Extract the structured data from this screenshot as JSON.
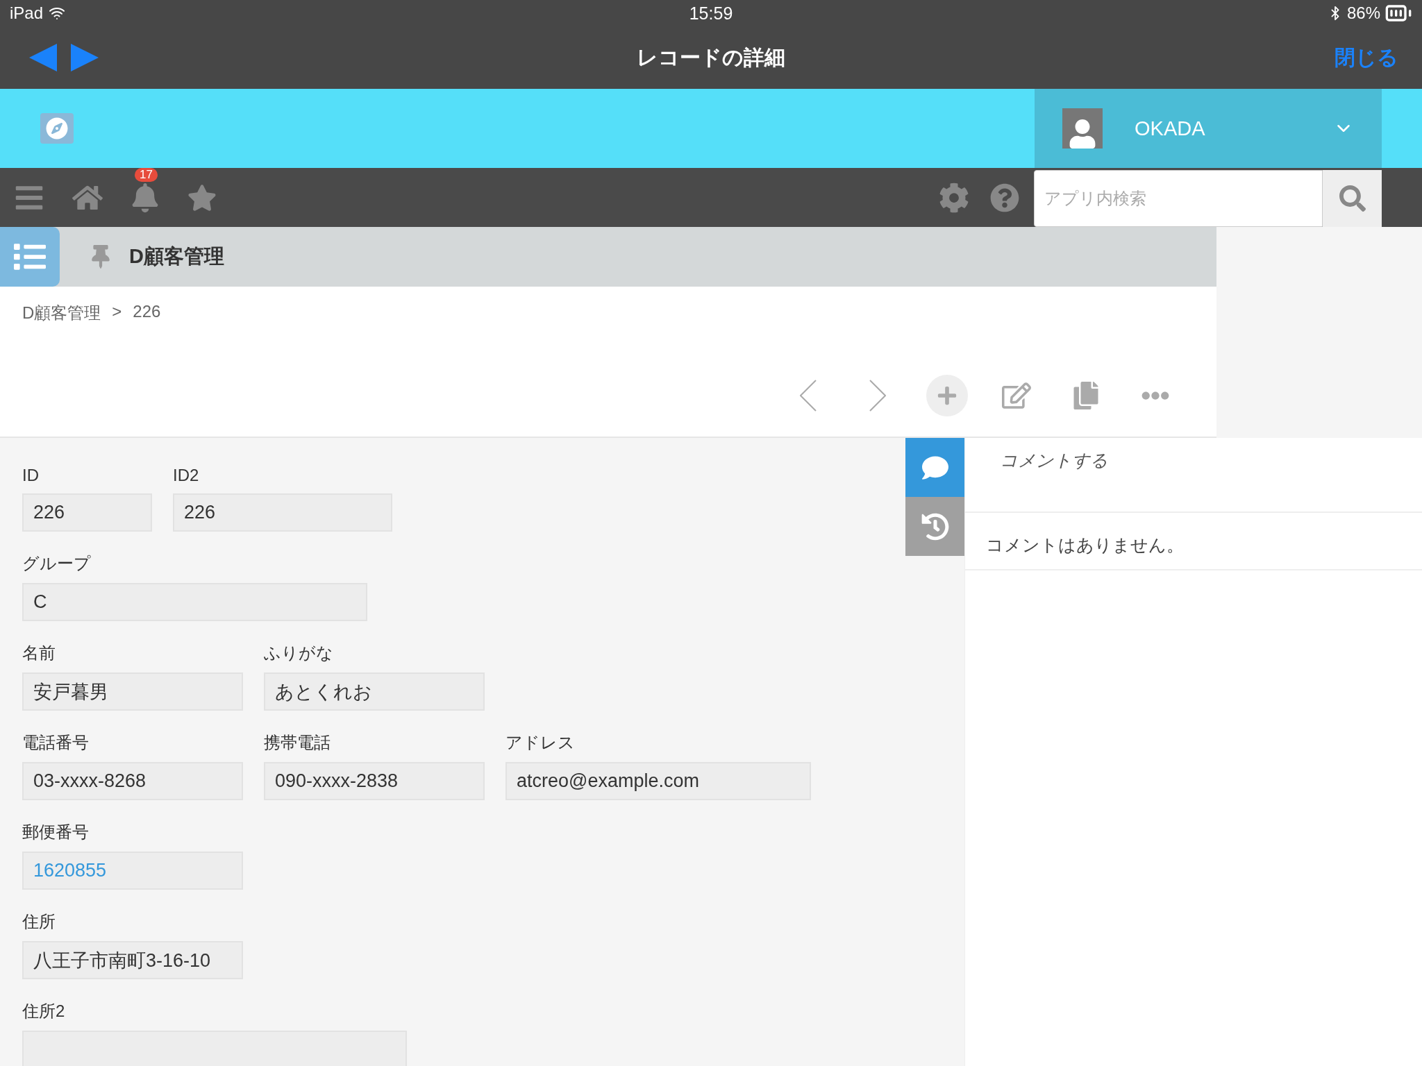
{
  "status_bar": {
    "device": "iPad",
    "time": "15:59",
    "battery": "86%"
  },
  "nav_bar": {
    "title": "レコードの詳細",
    "close": "閉じる"
  },
  "header": {
    "user": "OKADA"
  },
  "toolbar": {
    "notification_count": "17",
    "search": {
      "placeholder": "アプリ内検索"
    }
  },
  "app_bar": {
    "title": "D顧客管理"
  },
  "breadcrumb": [
    "D顧客管理",
    "226"
  ],
  "breadcrumb_separator": ">",
  "form_rows": [
    [
      {
        "label": "ID",
        "value": "226",
        "kind": "text"
      },
      {
        "label": "ID2",
        "value": "226",
        "kind": "text"
      }
    ],
    [
      {
        "label": "グループ",
        "value": "C",
        "kind": "text"
      }
    ],
    [
      {
        "label": "名前",
        "value": "安戸暮男",
        "kind": "text"
      },
      {
        "label": "ふりがな",
        "value": "あとくれお",
        "kind": "text"
      }
    ],
    [
      {
        "label": "電話番号",
        "value": "03-xxxx-8268",
        "kind": "text"
      },
      {
        "label": "携帯電話",
        "value": "090-xxxx-2838",
        "kind": "text"
      },
      {
        "label": "アドレス",
        "value": "atcreo@example.com",
        "kind": "text"
      }
    ],
    [
      {
        "label": "郵便番号",
        "value": "1620855",
        "kind": "link"
      }
    ],
    [
      {
        "label": "住所",
        "value": "八王子市南町3-16-10",
        "kind": "text"
      }
    ],
    [
      {
        "label": "住所2",
        "kind": "text"
      }
    ]
  ],
  "side_tabs": [
    {
      "kind": "comments",
      "selected": true
    },
    {
      "kind": "history",
      "selected": false
    }
  ],
  "comments": {
    "placeholder": "コメントする",
    "empty": "コメントはありません。"
  }
}
